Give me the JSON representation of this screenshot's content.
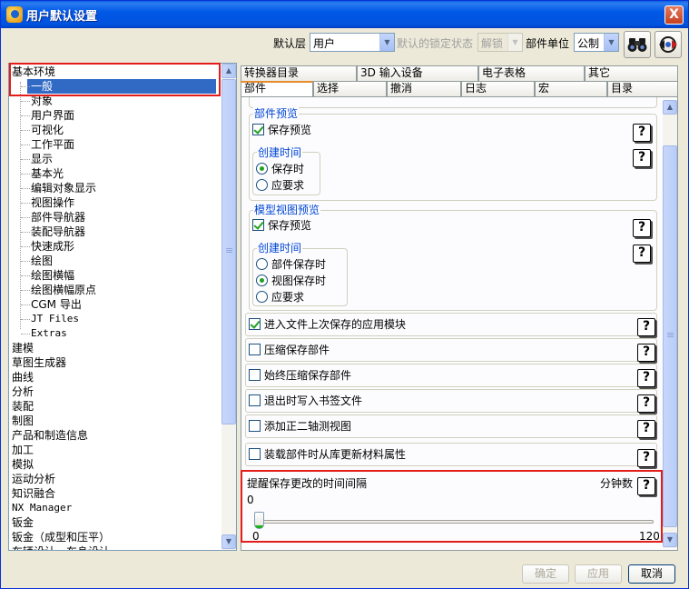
{
  "window": {
    "title": "用户默认设置",
    "close_label": "X"
  },
  "toolbar": {
    "default_layer_label": "默认层",
    "default_layer_value": "用户",
    "lock_status_label": "默认的锁定状态",
    "lock_status_value": "解锁",
    "unit_label": "部件单位",
    "unit_value": "公制",
    "search_icon": "binoculars-icon",
    "manager_icon": "settings-manager-icon"
  },
  "tree": {
    "items": [
      {
        "label": "基本环境",
        "level": 0
      },
      {
        "label": "一般",
        "level": 1,
        "selected": true
      },
      {
        "label": "对象",
        "level": 1
      },
      {
        "label": "用户界面",
        "level": 1
      },
      {
        "label": "可视化",
        "level": 1
      },
      {
        "label": "工作平面",
        "level": 1
      },
      {
        "label": "显示",
        "level": 1
      },
      {
        "label": "基本光",
        "level": 1
      },
      {
        "label": "编辑对象显示",
        "level": 1
      },
      {
        "label": "视图操作",
        "level": 1
      },
      {
        "label": "部件导航器",
        "level": 1
      },
      {
        "label": "装配导航器",
        "level": 1
      },
      {
        "label": "快速成形",
        "level": 1
      },
      {
        "label": "绘图",
        "level": 1
      },
      {
        "label": "绘图横幅",
        "level": 1
      },
      {
        "label": "绘图横幅原点",
        "level": 1
      },
      {
        "label": "CGM 导出",
        "level": 1
      },
      {
        "label": "JT Files",
        "level": 1,
        "mono": true
      },
      {
        "label": "Extras",
        "level": 1,
        "mono": true
      },
      {
        "label": "建模",
        "level": 0
      },
      {
        "label": "草图生成器",
        "level": 0
      },
      {
        "label": "曲线",
        "level": 0
      },
      {
        "label": "分析",
        "level": 0
      },
      {
        "label": "装配",
        "level": 0
      },
      {
        "label": "制图",
        "level": 0
      },
      {
        "label": "产品和制造信息",
        "level": 0
      },
      {
        "label": "加工",
        "level": 0
      },
      {
        "label": "模拟",
        "level": 0
      },
      {
        "label": "运动分析",
        "level": 0
      },
      {
        "label": "知识融合",
        "level": 0
      },
      {
        "label": "NX Manager",
        "level": 0,
        "mono": true
      },
      {
        "label": "钣金",
        "level": 0
      },
      {
        "label": "钣金（成型和压平）",
        "level": 0
      },
      {
        "label": "车辆设计 - 车身设计",
        "level": 0
      }
    ]
  },
  "tabs": {
    "row1": [
      "转换器目录",
      "3D 输入设备",
      "电子表格",
      "其它"
    ],
    "row2": [
      "部件",
      "选择",
      "撤消",
      "日志",
      "宏",
      "目录"
    ],
    "active": "部件"
  },
  "panel": {
    "part_preview": {
      "title": "部件预览",
      "save_preview": "保存预览",
      "save_preview_checked": true,
      "create_time_title": "创建时间",
      "options": [
        "保存时",
        "应要求"
      ],
      "selected": "保存时"
    },
    "model_view_preview": {
      "title": "模型视图预览",
      "save_preview": "保存预览",
      "save_preview_checked": true,
      "create_time_title": "创建时间",
      "options": [
        "部件保存时",
        "视图保存时",
        "应要求"
      ],
      "selected": "视图保存时"
    },
    "options": [
      {
        "label": "进入文件上次保存的应用模块",
        "checked": true
      },
      {
        "label": "压缩保存部件",
        "checked": false
      },
      {
        "label": "始终压缩保存部件",
        "checked": false
      },
      {
        "label": "退出时写入书签文件",
        "checked": false
      },
      {
        "label": "添加正二轴测视图",
        "checked": false
      },
      {
        "label": "装载部件时从库更新材料属性",
        "checked": false
      }
    ],
    "reminder": {
      "label": "提醒保存更改的时间间隔",
      "unit": "分钟数",
      "current_value": "0",
      "min": "0",
      "max": "120",
      "value_fraction": 0
    },
    "help_glyph": "?"
  },
  "buttons": {
    "ok": "确定",
    "apply": "应用",
    "cancel": "取消"
  },
  "colors": {
    "highlight_box": "#e31c1c",
    "selection": "#316ac5",
    "group_title": "#0046d5"
  }
}
